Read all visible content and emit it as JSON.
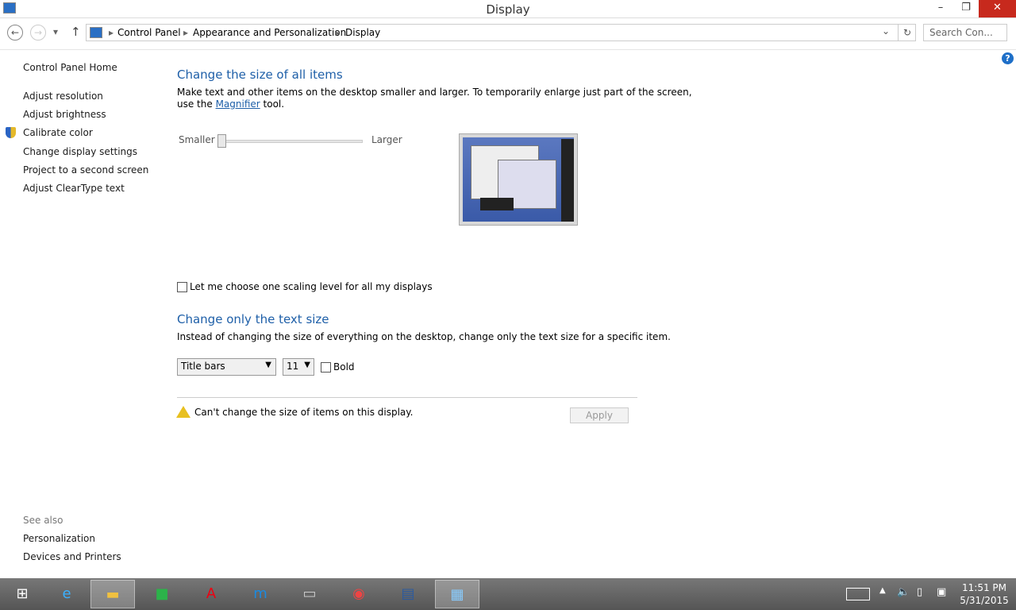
{
  "window": {
    "title": "Display",
    "minimize": "–",
    "restore": "❐",
    "close": "✕"
  },
  "nav": {
    "back": "←",
    "forward": "→",
    "recent": "▾",
    "up": "↑",
    "breadcrumb": [
      "Control Panel",
      "Appearance and Personalization",
      "Display"
    ],
    "search_placeholder": "Search Con...",
    "refresh": "↻",
    "dropdown": "⌄"
  },
  "help": "?",
  "sidebar": {
    "items": [
      "Control Panel Home",
      "Adjust resolution",
      "Adjust brightness",
      "Calibrate color",
      "Change display settings",
      "Project to a second screen",
      "Adjust ClearType text"
    ],
    "see_also": "See also",
    "see_also_items": [
      "Personalization",
      "Devices and Printers"
    ]
  },
  "main": {
    "heading1": "Change the size of all items",
    "desc1_a": "Make text and other items on the desktop smaller and larger. To temporarily enlarge just part of the screen,",
    "desc1_b": "use the ",
    "magnifier": "Magnifier",
    "desc1_c": " tool.",
    "slider_min": "Smaller",
    "slider_max": "Larger",
    "slider_value": 0,
    "scaling_checkbox": "Let me choose one scaling level for all my displays",
    "scaling_checked": false,
    "heading2": "Change only the text size",
    "desc2": "Instead of changing the size of everything on the desktop, change only the text size for a specific item.",
    "item_select": "Title bars",
    "size_select": "11",
    "bold_label": "Bold",
    "bold_checked": false,
    "warning": "Can't change the size of items on this display.",
    "apply": "Apply"
  },
  "taskbar": {
    "time": "11:51 PM",
    "date": "5/31/2015",
    "apps": [
      "windows-start",
      "internet-explorer",
      "file-explorer",
      "store",
      "adobe",
      "maxthon",
      "lenovo",
      "chrome",
      "writer",
      "control-panel"
    ]
  }
}
